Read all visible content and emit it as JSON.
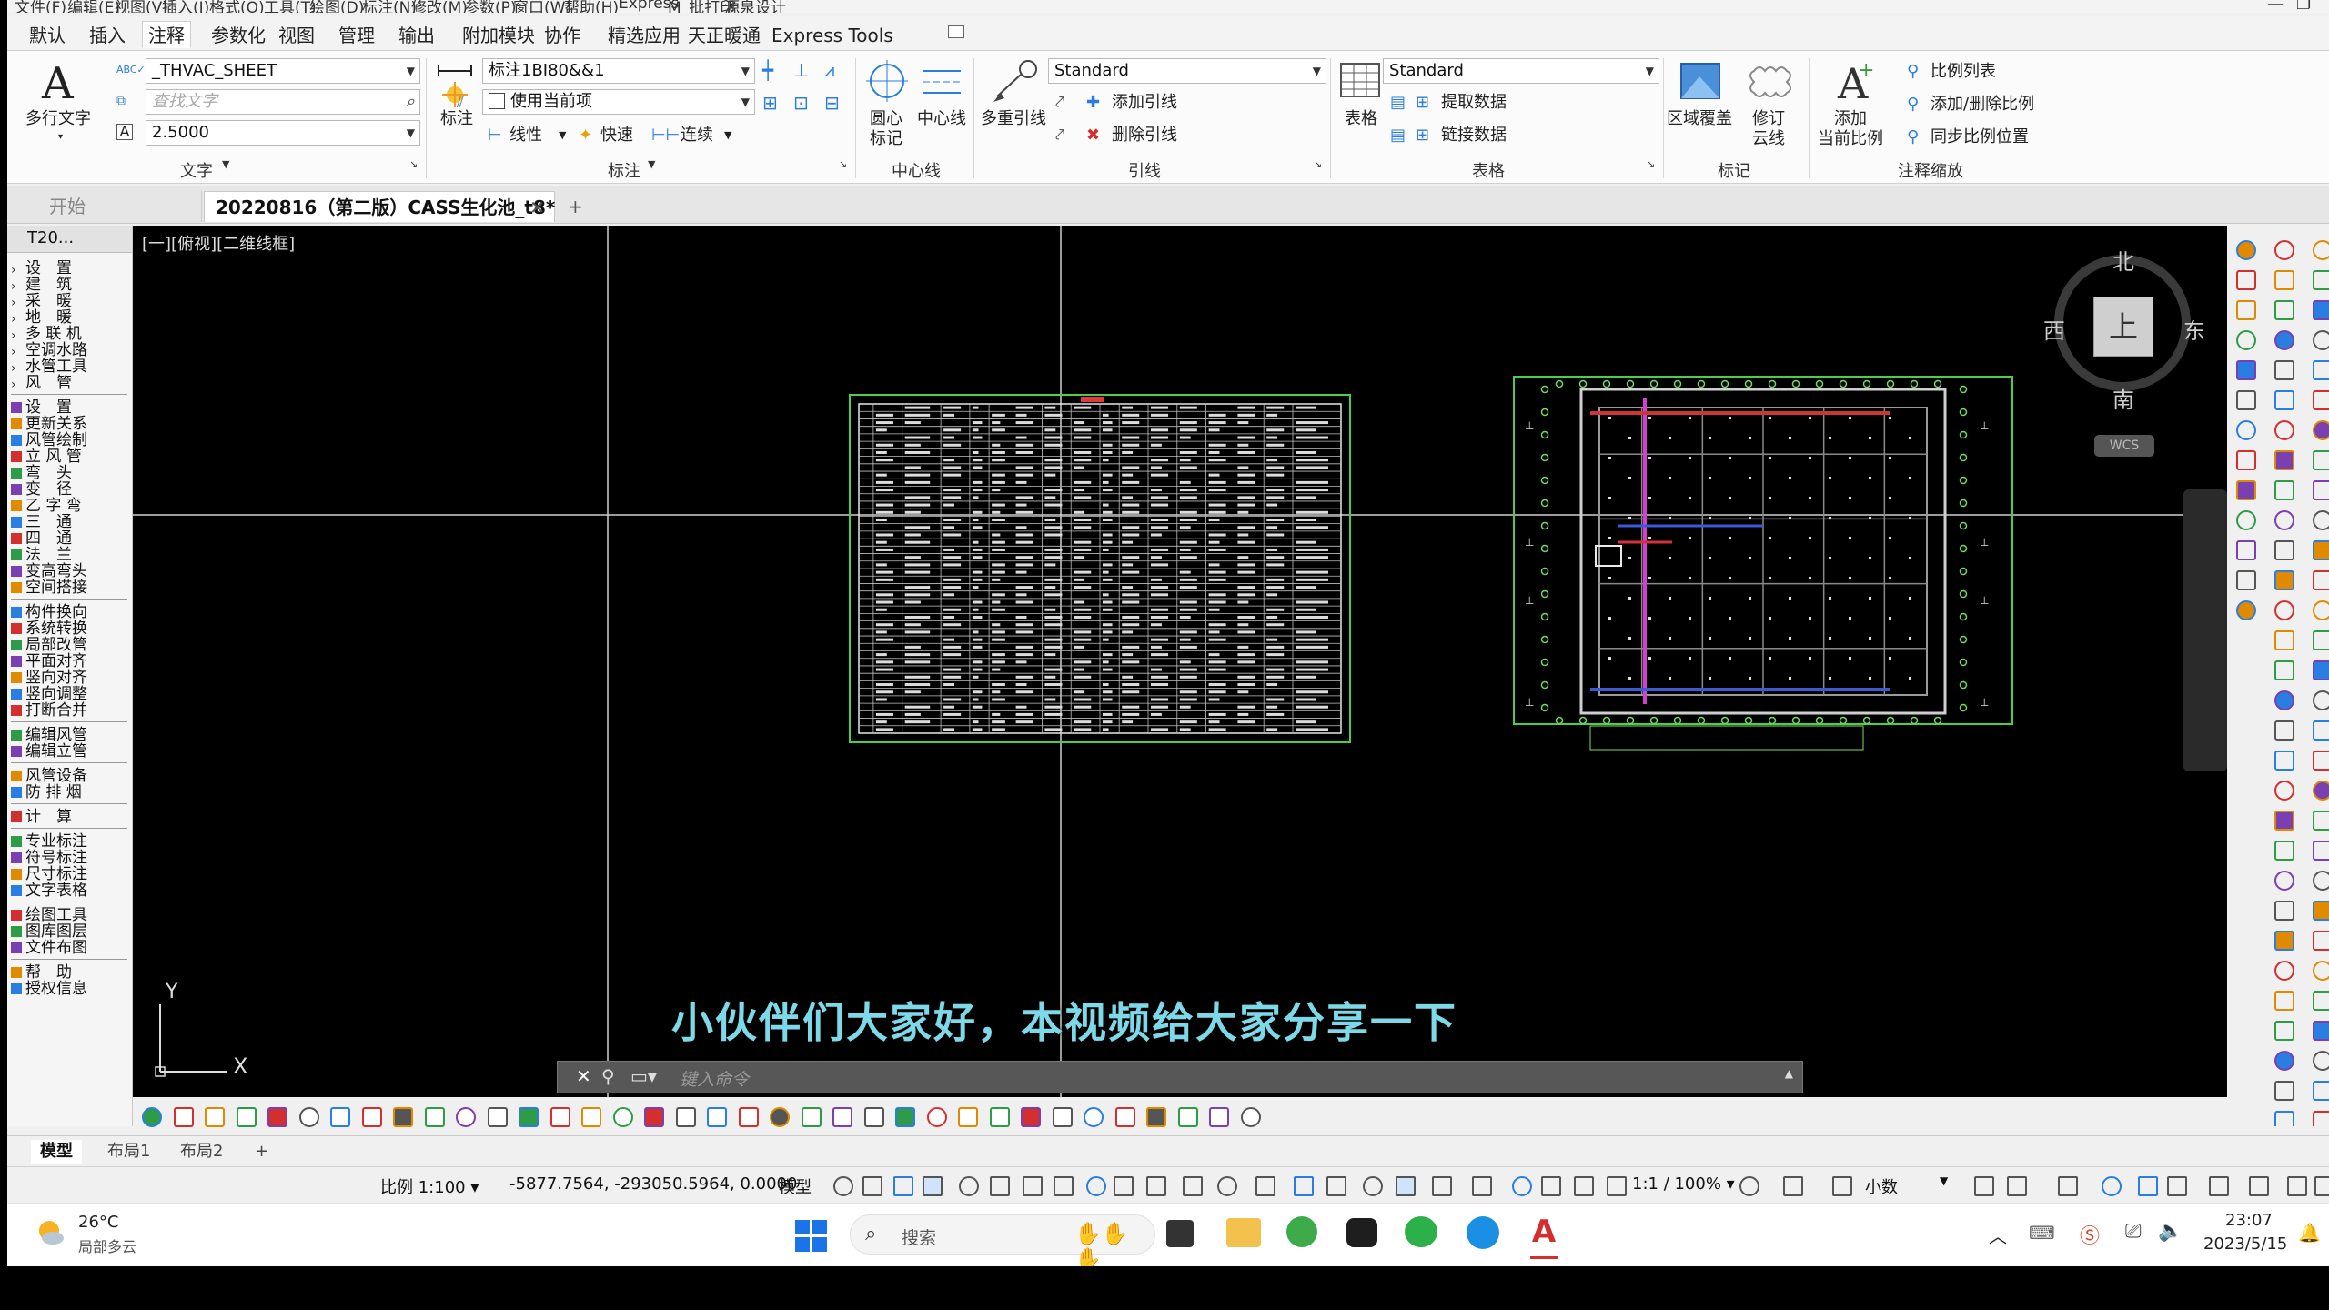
{
  "menu": [
    "文件(F)",
    "编辑(E)",
    "视图(V)",
    "插入(I)",
    "格式(O)",
    "工具(T)",
    "绘图(D)",
    "标注(N)",
    "修改(M)",
    "参数(P)",
    "窗口(W)",
    "帮助(H)",
    "Express",
    "M_批打印",
    "源泉设计"
  ],
  "ribbon_tabs": [
    "默认",
    "插入",
    "注释",
    "参数化",
    "视图",
    "管理",
    "输出",
    "附加模块",
    "协作",
    "精选应用",
    "天正暖通",
    "Express Tools"
  ],
  "active_tab": "注释",
  "ribbon": {
    "text_panel": {
      "title": "文字",
      "multiline_text": "多行文字",
      "style": "_THVAC_SHEET",
      "find_placeholder": "查找文字",
      "height": "2.5000"
    },
    "dim_panel": {
      "title": "标注",
      "dim_btn": "标注",
      "dim_style": "标注1BI80&&1",
      "use_current": "使用当前项",
      "linear": "线性",
      "quick": "快速",
      "continuous": "连续"
    },
    "centerline_panel": {
      "title": "中心线",
      "center_mark": "圆心\n标记",
      "center_line": "中心线"
    },
    "leader_panel": {
      "title": "引线",
      "multileader": "多重引线",
      "style": "Standard",
      "add_leader": "添加引线",
      "remove_leader": "删除引线"
    },
    "table_panel": {
      "title": "表格",
      "table_btn": "表格",
      "style": "Standard",
      "extract": "提取数据",
      "link": "链接数据"
    },
    "markup_panel": {
      "title": "标记",
      "wipeout": "区域覆盖",
      "revcloud": "修订\n云线"
    },
    "scale_panel": {
      "title": "注释缩放",
      "add_current": "添加\n当前比例",
      "scale_list": "比例列表",
      "add_delete": "添加/删除比例",
      "sync": "同步比例位置"
    }
  },
  "doc_tabs": {
    "start": "开始",
    "active": "20220816（第二版）CASS生化池_t8*",
    "add": "+"
  },
  "left_panel": {
    "header": "T20...",
    "items": [
      "设　置",
      "建　筑",
      "采　暖",
      "地　暖",
      "多 联 机",
      "空调水路",
      "水管工具",
      "风　管",
      "设　置",
      "更新关系",
      "风管绘制",
      "立 风 管",
      "弯　头",
      "变　径",
      "乙 字 弯",
      "三　通",
      "四　通",
      "法　兰",
      "变高弯头",
      "空间搭接",
      "构件换向",
      "系统转换",
      "局部改管",
      "平面对齐",
      "竖向对齐",
      "竖向调整",
      "打断合并",
      "编辑风管",
      "编辑立管",
      "风管设备",
      "防 排 烟",
      "计　算",
      "专业标注",
      "符号标注",
      "尺寸标注",
      "文字表格",
      "绘图工具",
      "图库图层",
      "文件布图",
      "帮　助",
      "授权信息"
    ]
  },
  "viewport": {
    "label": "[一][俯视][二维线框]",
    "compass": {
      "n": "北",
      "s": "南",
      "e": "东",
      "w": "西",
      "top": "上",
      "wcs": "WCS"
    },
    "ucs": {
      "x": "X",
      "y": "Y"
    }
  },
  "command_placeholder": "键入命令",
  "subtitle": "小伙伴们大家好，本视频给大家分享一下",
  "layout_tabs": [
    "模型",
    "布局1",
    "布局2",
    "+"
  ],
  "status": {
    "scale": "比例 1:100",
    "coords": "-5877.7564, -293050.5964, 0.0000",
    "model": "模型",
    "annoscale": "1:1 / 100%",
    "decimal": "小数"
  },
  "taskbar": {
    "temp": "26°C",
    "weather": "局部多云",
    "search": "搜索",
    "time": "23:07",
    "date": "2023/5/15"
  },
  "colors": {
    "accent": "#2a7de1",
    "autocad_red": "#d32f2f",
    "canvas": "#000000",
    "subtitle": "#7dd9e8"
  }
}
